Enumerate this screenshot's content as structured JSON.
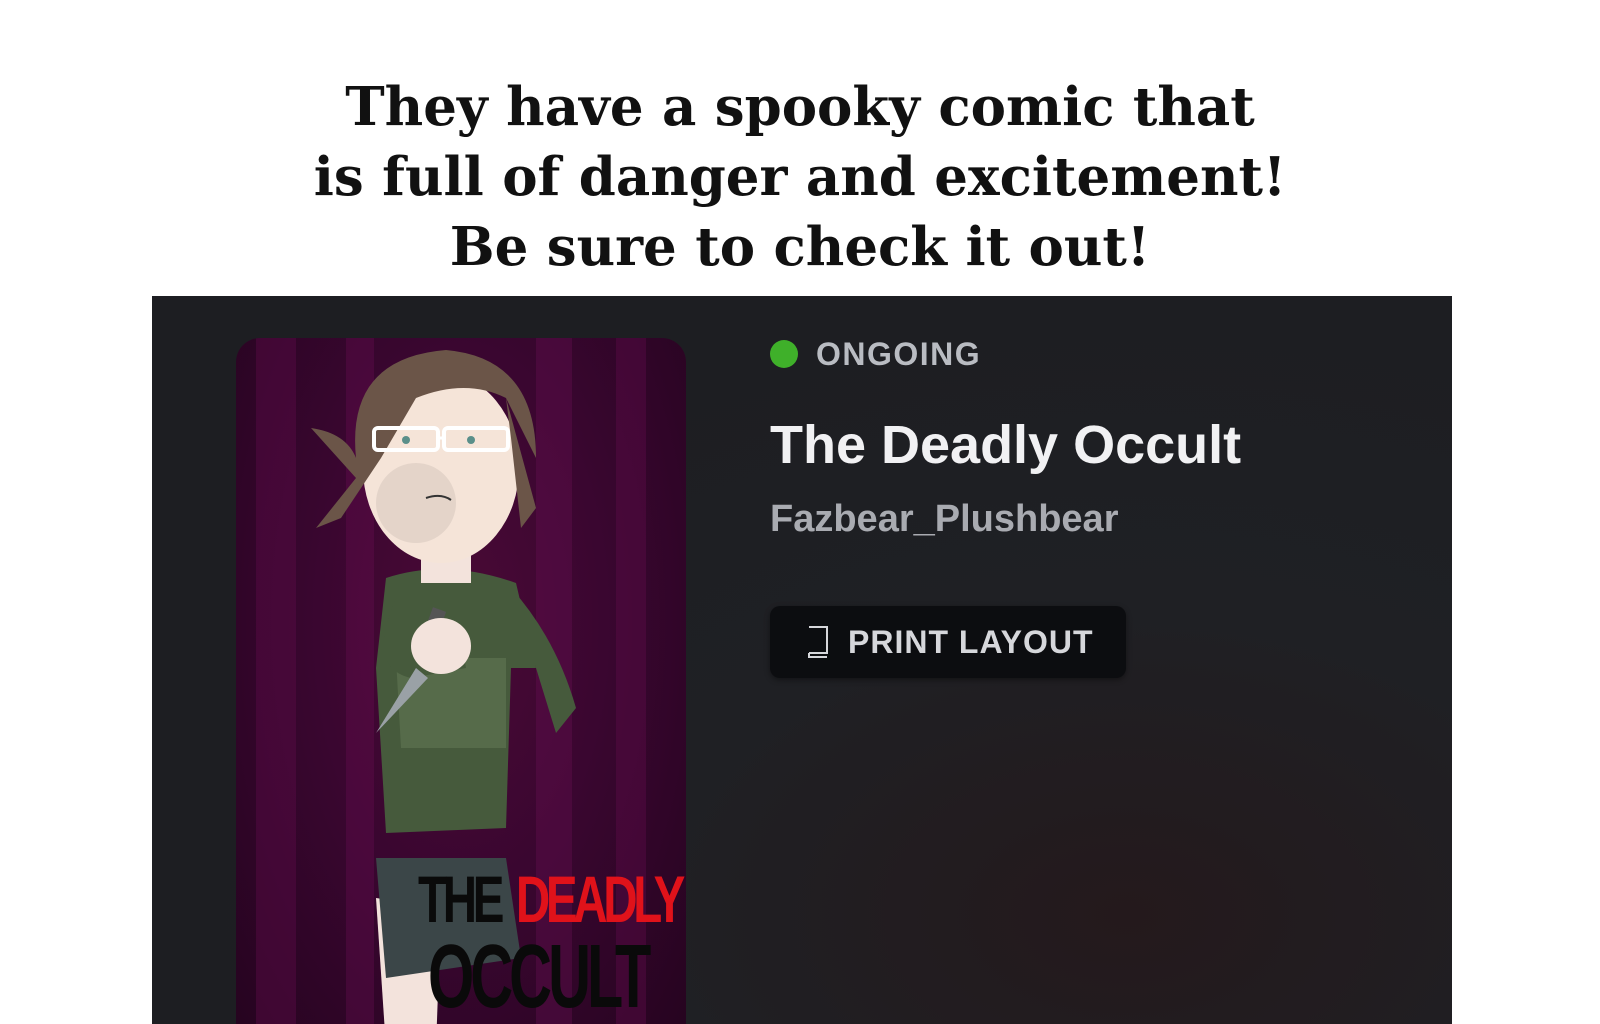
{
  "caption": {
    "lines": [
      "They have a spooky comic that",
      "is full of danger and excitement!",
      "Be sure to check it out!"
    ]
  },
  "comic": {
    "status": "ONGOING",
    "status_color": "#3fb02a",
    "title": "The Deadly Occult",
    "author": "Fazbear_Plushbear",
    "print_button_label": "PRINT LAYOUT",
    "print_button_icon": "book-icon",
    "cover": {
      "title_word_1": "THE",
      "title_word_2": "DEADLY",
      "title_word_3": "OCCULT",
      "accent_red": "#e0121a"
    }
  },
  "colors": {
    "panel_background": "#1d1e22",
    "cover_background": "#3a0630"
  }
}
